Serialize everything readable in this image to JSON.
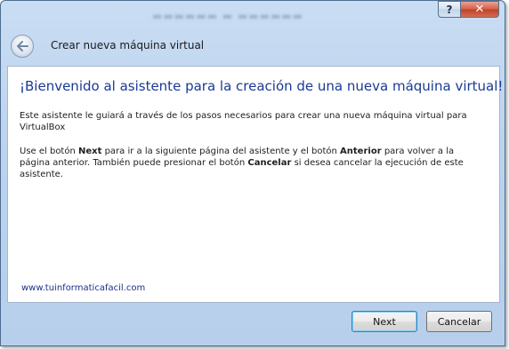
{
  "window": {
    "caption_help": "?",
    "caption_close": "✕"
  },
  "header": {
    "title": "Crear nueva máquina virtual"
  },
  "content": {
    "heading": "¡Bienvenido al asistente para la creación de una nueva máquina virtual!",
    "paragraph1": "Este asistente le guiará a través de los pasos necesarios para crear una nueva máquina virtual para VirtualBox",
    "paragraph2": {
      "part1": "Use el botón ",
      "next_word": "Next",
      "part2": " para ir a la siguiente página del asistente y el botón ",
      "anterior_word": "Anterior",
      "part3": " para volver a la página anterior. También puede presionar el botón ",
      "cancel_word": "Cancelar",
      "part4": " si desea cancelar la ejecución de este asistente."
    },
    "watermark": "www.tuinformaticafacil.com"
  },
  "footer": {
    "next_label": "Next",
    "cancel_label": "Cancelar"
  }
}
